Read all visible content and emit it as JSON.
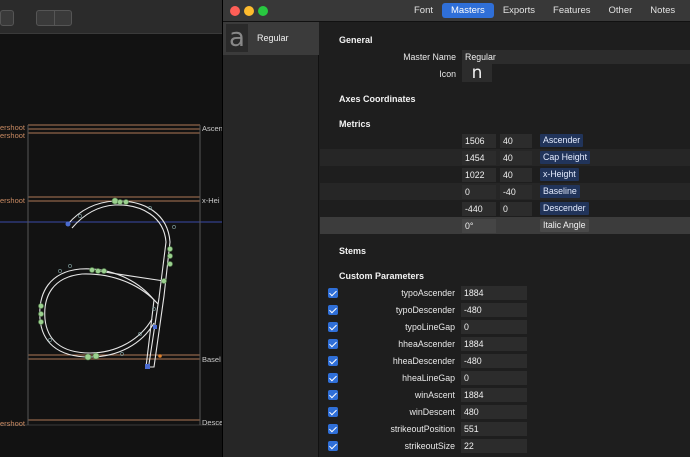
{
  "tabs": [
    "Font",
    "Masters",
    "Exports",
    "Features",
    "Other",
    "Notes"
  ],
  "active_tab": "Masters",
  "master_list": {
    "item_name": "Regular",
    "thumb_glyph": "a"
  },
  "general": {
    "heading": "General",
    "master_name_label": "Master Name",
    "master_name_value": "Regular",
    "icon_label": "Icon",
    "icon_glyph": "n"
  },
  "axes": {
    "heading": "Axes Coordinates"
  },
  "metrics": {
    "heading": "Metrics",
    "rows": [
      {
        "value": "1506",
        "overshoot": "40",
        "name": "Ascender"
      },
      {
        "value": "1454",
        "overshoot": "40",
        "name": "Cap Height"
      },
      {
        "value": "1022",
        "overshoot": "40",
        "name": "x-Height"
      },
      {
        "value": "0",
        "overshoot": "-40",
        "name": "Baseline"
      },
      {
        "value": "-440",
        "overshoot": "0",
        "name": "Descender"
      },
      {
        "value": "0°",
        "overshoot": "",
        "name": "Italic Angle"
      }
    ]
  },
  "stems": {
    "heading": "Stems"
  },
  "custom_parameters": {
    "heading": "Custom Parameters",
    "rows": [
      {
        "name": "typoAscender",
        "value": "1884"
      },
      {
        "name": "typoDescender",
        "value": "-480"
      },
      {
        "name": "typoLineGap",
        "value": "0"
      },
      {
        "name": "hheaAscender",
        "value": "1884"
      },
      {
        "name": "hheaDescender",
        "value": "-480"
      },
      {
        "name": "hheaLineGap",
        "value": "0"
      },
      {
        "name": "winAscent",
        "value": "1884"
      },
      {
        "name": "winDescent",
        "value": "480"
      },
      {
        "name": "strikeoutPosition",
        "value": "551"
      },
      {
        "name": "strikeoutSize",
        "value": "22"
      }
    ]
  },
  "editor": {
    "left_labels": [
      "ershoot",
      "ershoot",
      "ershoot",
      "ershoot"
    ],
    "right_labels": [
      "Ascen",
      "x-Hei",
      "Basel",
      "Desce"
    ]
  },
  "colors": {
    "accent": "#2f6fd8",
    "metric_line": "#c98a62"
  }
}
